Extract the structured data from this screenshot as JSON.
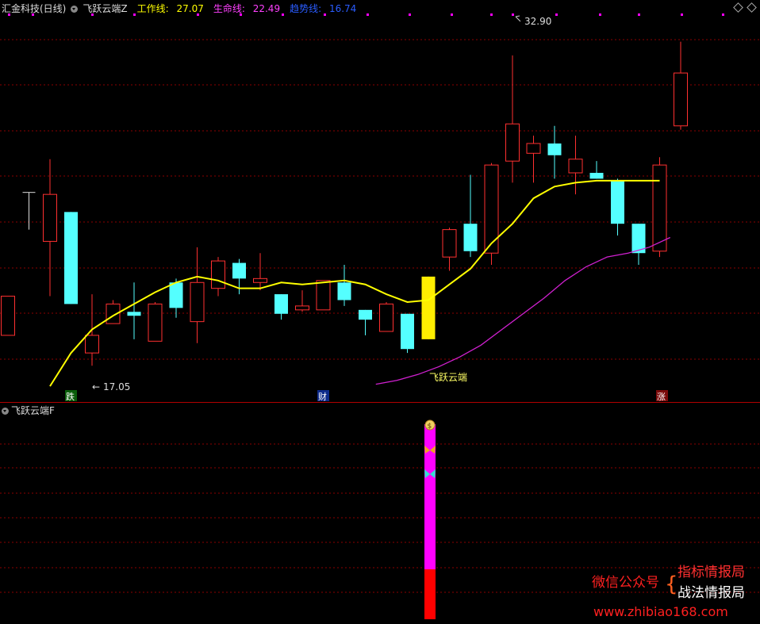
{
  "header": {
    "stock_name": "汇金科技(日线)",
    "indicator_name": "飞跃云端Z",
    "work_line_label": "工作线:",
    "work_line_value": "27.07",
    "life_line_label": "生命线:",
    "life_line_value": "22.49",
    "trend_line_label": "趋势线:",
    "trend_line_value": "16.74"
  },
  "sub_panel": {
    "title": "飞跃云端F"
  },
  "annotations": {
    "high_price": "32.90",
    "low_price": "17.05",
    "signal_text": "飞跃云端",
    "tag_fall": "跌",
    "tag_wealth": "财",
    "tag_rise": "涨"
  },
  "watermark": {
    "wechat": "微信公众号",
    "line1": "指标情报局",
    "line2": "战法情报局",
    "url": "www.zhibiao168.com"
  },
  "colors": {
    "up": "#ff3030",
    "down": "#54ffff",
    "work_line": "#ffff00",
    "trend_line": "#ff40ff",
    "grid": "#8b0000"
  },
  "chart_data": {
    "type": "candlestick",
    "price_range": [
      15.6,
      35.0
    ],
    "candles": [
      {
        "o": 20.6,
        "h": 20.6,
        "l": 18.6,
        "c": 18.6,
        "dir": "up"
      },
      {
        "o": 25.9,
        "h": 25.9,
        "l": 24.0,
        "c": 24.0,
        "dir": "flat"
      },
      {
        "o": 23.4,
        "h": 27.6,
        "l": 20.6,
        "c": 25.8,
        "dir": "up"
      },
      {
        "o": 24.9,
        "h": 24.9,
        "l": 20.2,
        "c": 20.2,
        "dir": "down"
      },
      {
        "o": 17.7,
        "h": 20.7,
        "l": 17.05,
        "c": 18.6,
        "dir": "up"
      },
      {
        "o": 19.2,
        "h": 20.4,
        "l": 19.2,
        "c": 20.2,
        "dir": "up"
      },
      {
        "o": 19.8,
        "h": 21.3,
        "l": 18.4,
        "c": 19.6,
        "dir": "down"
      },
      {
        "o": 18.3,
        "h": 20.3,
        "l": 18.3,
        "c": 20.2,
        "dir": "up"
      },
      {
        "o": 21.3,
        "h": 21.5,
        "l": 19.5,
        "c": 20.0,
        "dir": "down"
      },
      {
        "o": 19.3,
        "h": 23.1,
        "l": 18.2,
        "c": 21.3,
        "dir": "up"
      },
      {
        "o": 21.0,
        "h": 22.6,
        "l": 20.6,
        "c": 22.4,
        "dir": "up"
      },
      {
        "o": 22.3,
        "h": 22.5,
        "l": 20.7,
        "c": 21.5,
        "dir": "down"
      },
      {
        "o": 21.3,
        "h": 22.8,
        "l": 20.9,
        "c": 21.5,
        "dir": "up"
      },
      {
        "o": 20.7,
        "h": 20.7,
        "l": 19.4,
        "c": 19.7,
        "dir": "down"
      },
      {
        "o": 19.9,
        "h": 20.9,
        "l": 19.8,
        "c": 20.1,
        "dir": "up"
      },
      {
        "o": 19.9,
        "h": 21.4,
        "l": 19.9,
        "c": 21.4,
        "dir": "up"
      },
      {
        "o": 21.3,
        "h": 22.2,
        "l": 20.1,
        "c": 20.4,
        "dir": "down"
      },
      {
        "o": 19.9,
        "h": 19.9,
        "l": 18.6,
        "c": 19.4,
        "dir": "down"
      },
      {
        "o": 18.8,
        "h": 20.3,
        "l": 18.8,
        "c": 20.2,
        "dir": "up"
      },
      {
        "o": 19.7,
        "h": 19.7,
        "l": 17.7,
        "c": 17.9,
        "dir": "down"
      },
      {
        "o": 18.4,
        "h": 21.6,
        "l": 18.4,
        "c": 21.6,
        "dir": "signal"
      },
      {
        "o": 22.6,
        "h": 24.1,
        "l": 21.9,
        "c": 24.0,
        "dir": "up"
      },
      {
        "o": 24.3,
        "h": 26.8,
        "l": 22.6,
        "c": 22.9,
        "dir": "down"
      },
      {
        "o": 22.8,
        "h": 27.4,
        "l": 22.2,
        "c": 27.3,
        "dir": "up"
      },
      {
        "o": 27.5,
        "h": 32.9,
        "l": 26.4,
        "c": 29.4,
        "dir": "up"
      },
      {
        "o": 27.9,
        "h": 28.8,
        "l": 26.4,
        "c": 28.4,
        "dir": "up"
      },
      {
        "o": 28.4,
        "h": 29.3,
        "l": 26.6,
        "c": 27.8,
        "dir": "down"
      },
      {
        "o": 26.9,
        "h": 28.8,
        "l": 25.8,
        "c": 27.6,
        "dir": "up"
      },
      {
        "o": 26.9,
        "h": 27.5,
        "l": 26.6,
        "c": 26.6,
        "dir": "down"
      },
      {
        "o": 26.5,
        "h": 26.6,
        "l": 23.7,
        "c": 24.3,
        "dir": "down"
      },
      {
        "o": 24.3,
        "h": 24.3,
        "l": 22.2,
        "c": 22.8,
        "dir": "down"
      },
      {
        "o": 22.9,
        "h": 27.7,
        "l": 22.6,
        "c": 27.3,
        "dir": "up"
      },
      {
        "o": 29.3,
        "h": 33.6,
        "l": 29.1,
        "c": 32.0,
        "dir": "up"
      }
    ],
    "work_line": [
      16.0,
      17.7,
      18.9,
      19.6,
      20.2,
      20.8,
      21.3,
      21.6,
      21.4,
      21.0,
      21.0,
      21.3,
      21.2,
      21.3,
      21.4,
      21.2,
      20.7,
      20.3,
      20.4,
      21.2,
      22.0,
      23.3,
      24.3,
      25.6,
      26.2,
      26.4,
      26.5,
      26.5,
      26.5,
      26.5
    ],
    "trend_line": [
      16.1,
      16.3,
      16.6,
      17.0,
      17.5,
      18.1,
      18.9,
      19.7,
      20.5,
      21.4,
      22.1,
      22.6,
      22.8,
      23.1,
      23.6
    ],
    "subpanel_bar": {
      "magenta_top": 0.5,
      "red_start": 0.17
    }
  }
}
